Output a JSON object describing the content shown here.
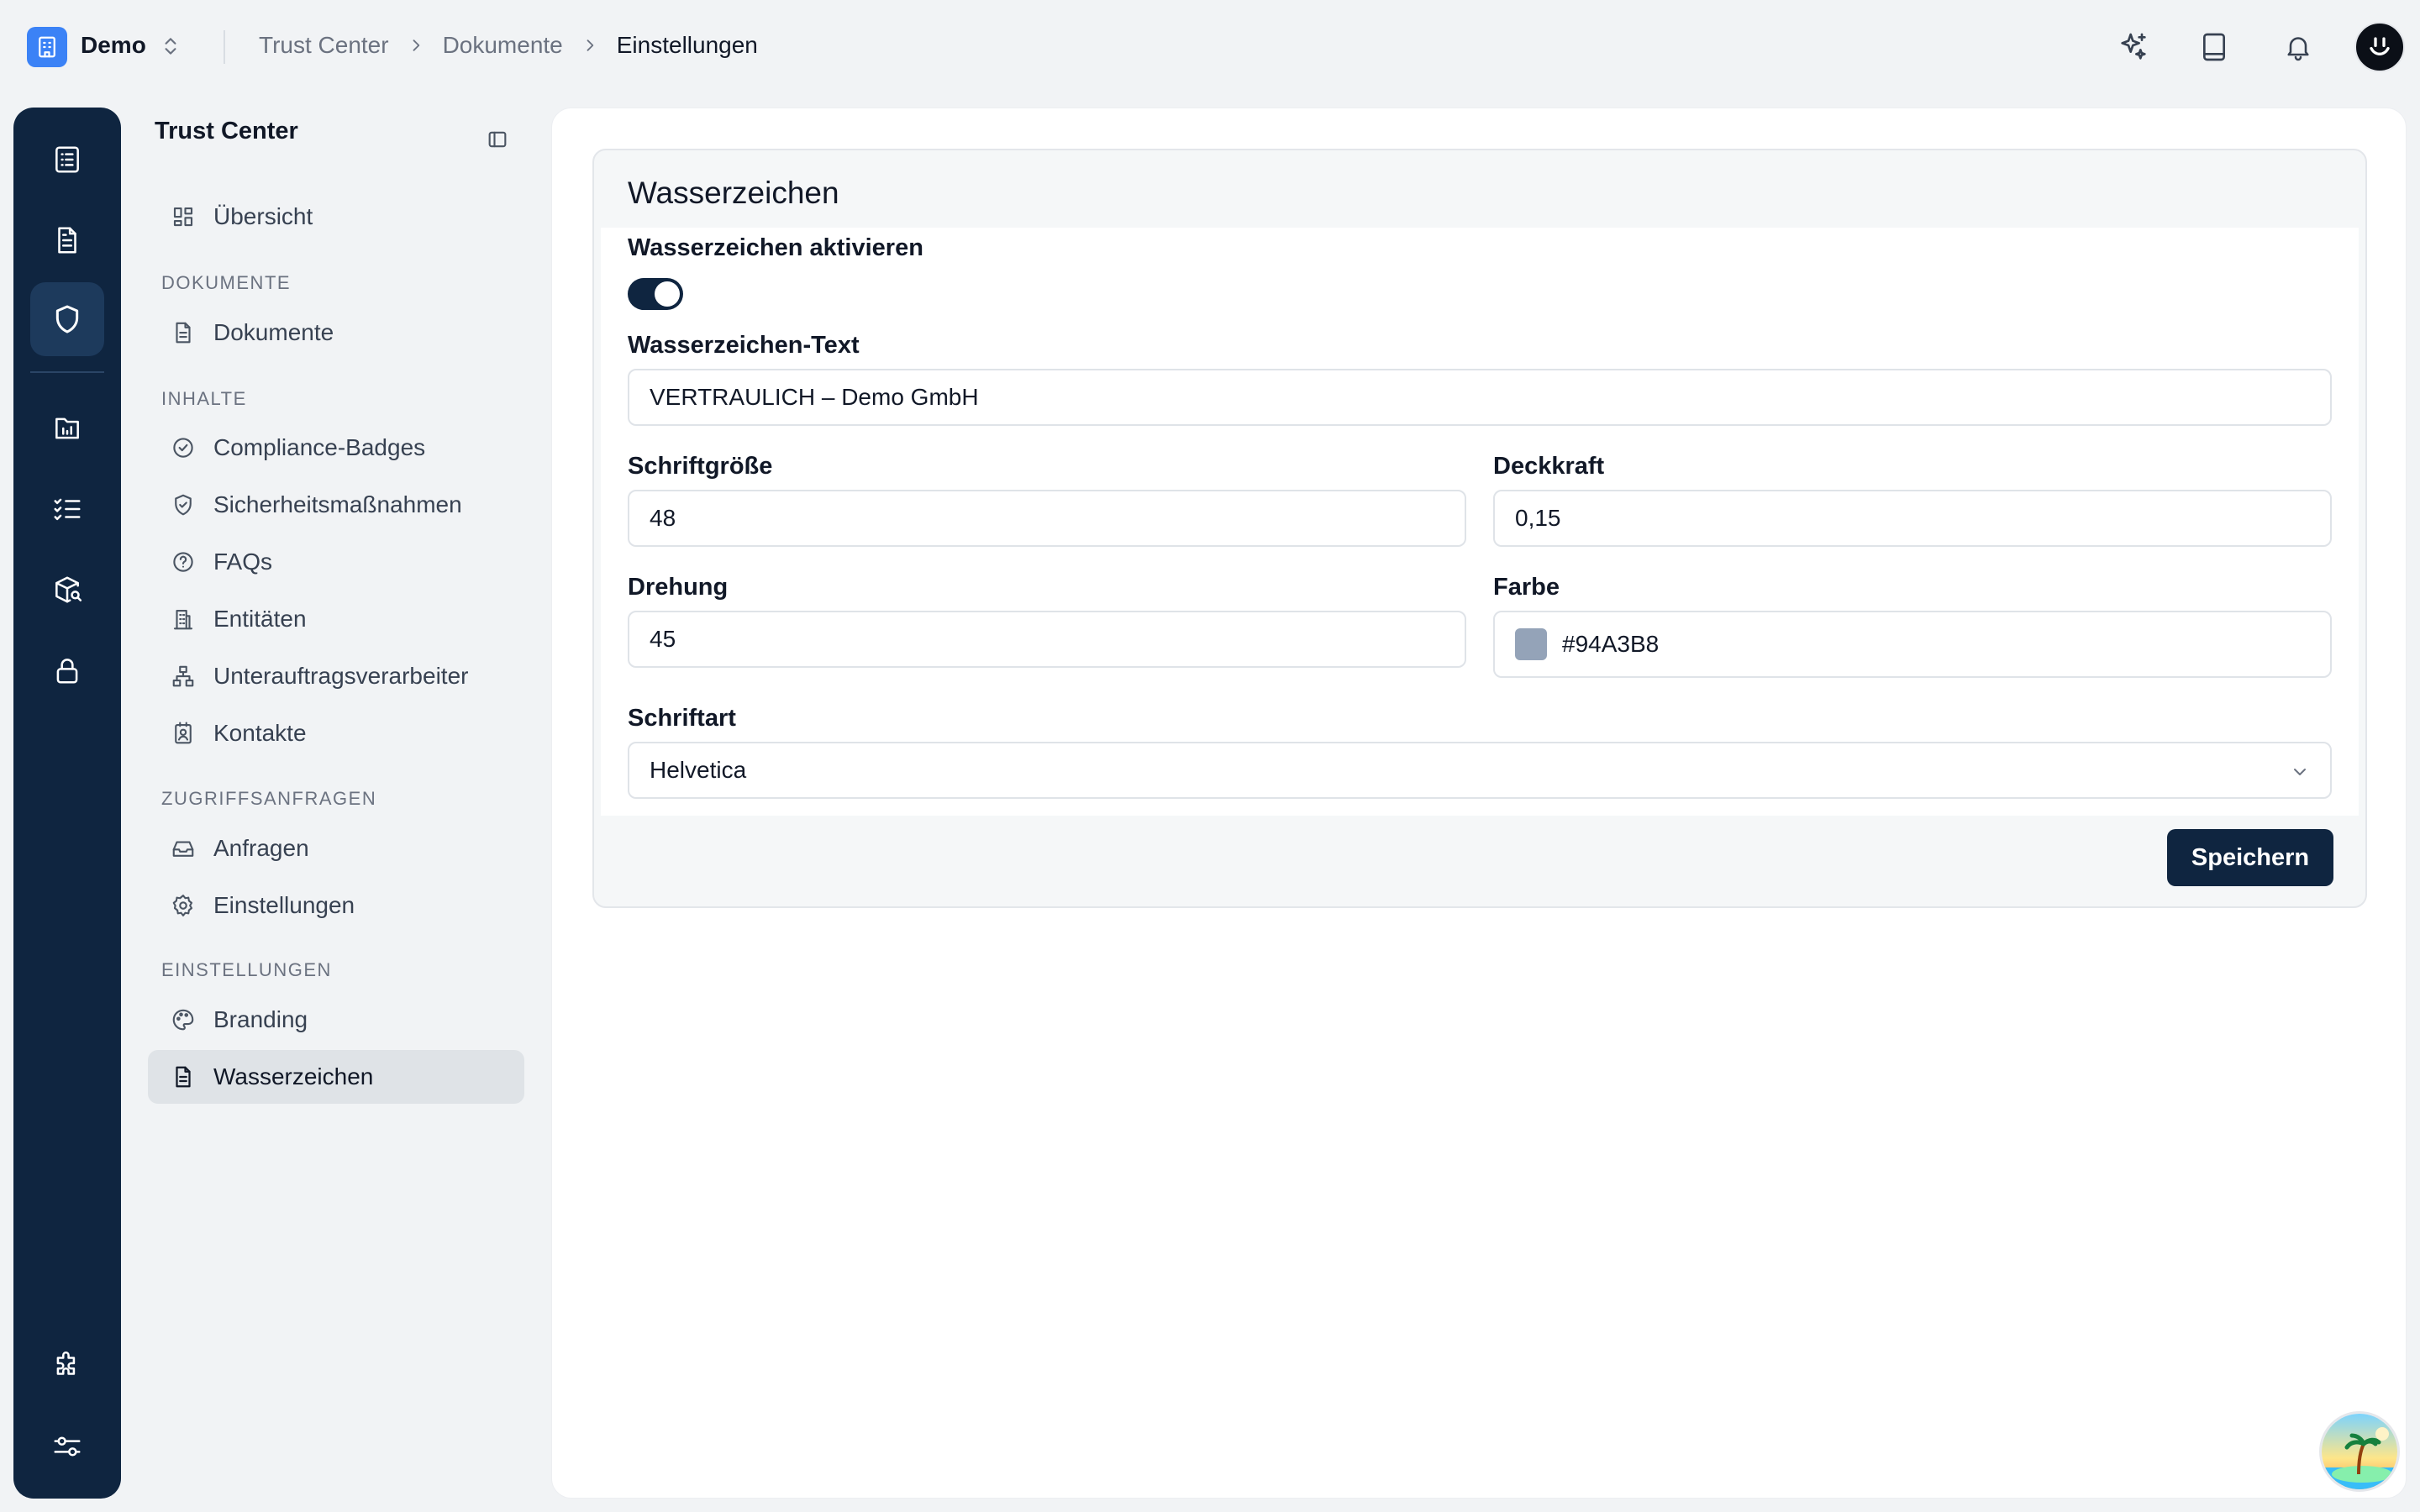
{
  "workspace": {
    "name": "Demo"
  },
  "breadcrumb": [
    "Trust Center",
    "Dokumente",
    "Einstellungen"
  ],
  "sidebar": {
    "title": "Trust Center",
    "overview": "Übersicht",
    "groups": {
      "documents": "DOKUMENTE",
      "content": "INHALTE",
      "access": "ZUGRIFFSANFRAGEN",
      "settings": "EINSTELLUNGEN"
    },
    "items": {
      "documents": "Dokumente",
      "badges": "Compliance-Badges",
      "security": "Sicherheitsmaßnahmen",
      "faqs": "FAQs",
      "entities": "Entitäten",
      "subprocessors": "Unterauftragsverarbeiter",
      "contacts": "Kontakte",
      "requests": "Anfragen",
      "access_settings": "Einstellungen",
      "branding": "Branding",
      "watermark": "Wasserzeichen"
    }
  },
  "card": {
    "title": "Wasserzeichen",
    "enable_label": "Wasserzeichen aktivieren",
    "enabled": true,
    "text_label": "Wasserzeichen-Text",
    "text_value": "VERTRAULICH – Demo GmbH",
    "font_size_label": "Schriftgröße",
    "font_size_value": "48",
    "opacity_label": "Deckkraft",
    "opacity_value": "0,15",
    "rotation_label": "Drehung",
    "rotation_value": "45",
    "color_label": "Farbe",
    "color_value": "#94A3B8",
    "font_label": "Schriftart",
    "font_value": "Helvetica",
    "save_label": "Speichern"
  },
  "colors": {
    "accent": "#0f2540",
    "rail_active": "#1d3a5c",
    "watermark_swatch": "#94A3B8",
    "workspace_logo": "#3b82f6"
  }
}
